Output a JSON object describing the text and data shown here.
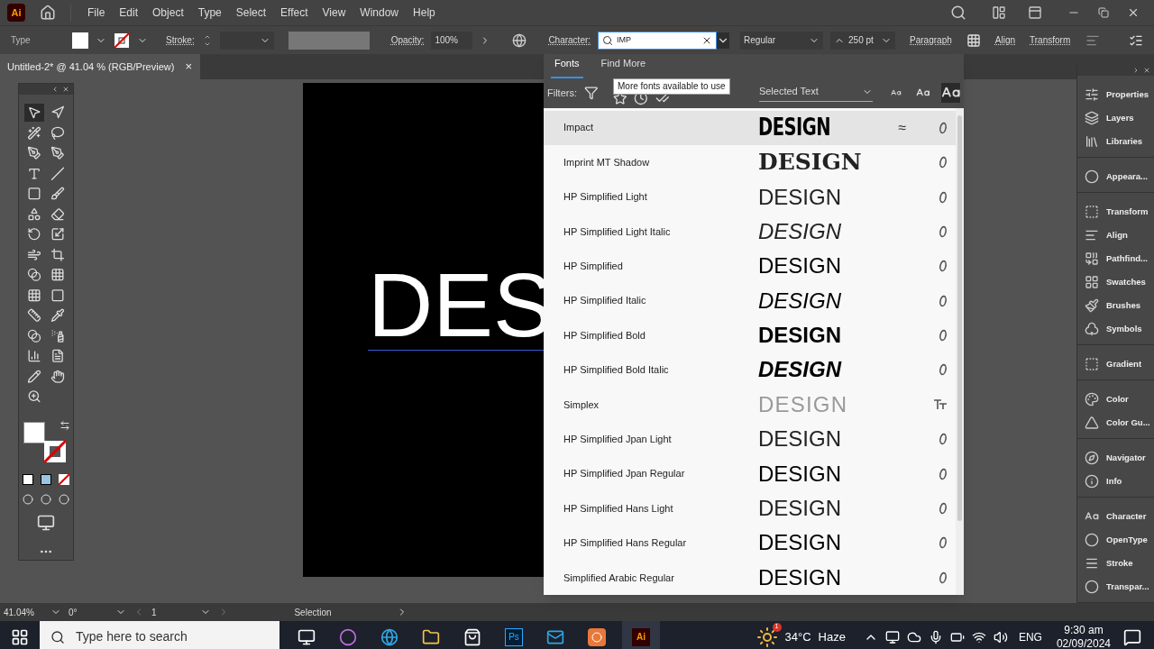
{
  "app_logo": "Ai",
  "menu": [
    "File",
    "Edit",
    "Object",
    "Type",
    "Select",
    "Effect",
    "View",
    "Window",
    "Help"
  ],
  "control_bar": {
    "mode": "Type",
    "stroke_label": "Stroke:",
    "opacity_label": "Opacity:",
    "opacity": "100%",
    "character_label": "Character:",
    "font_search": "IMP",
    "style": "Regular",
    "size": "250 pt",
    "links": [
      "Paragraph",
      "Align",
      "Transform"
    ]
  },
  "document_tab": {
    "title": "Untitled-2* @ 41.04 % (RGB/Preview)",
    "close": "×"
  },
  "tools": [
    {
      "selected": true
    },
    {
      "selected": false
    },
    {
      "selected": false
    },
    {
      "selected": false
    },
    {
      "selected": false
    },
    {
      "selected": false
    },
    {
      "selected": false
    },
    {
      "selected": false
    },
    {
      "selected": false
    },
    {
      "selected": false
    },
    {
      "selected": false
    },
    {
      "selected": false
    },
    {
      "selected": false
    },
    {
      "selected": false
    },
    {
      "selected": false
    },
    {
      "selected": false
    },
    {
      "selected": false
    },
    {
      "selected": false
    },
    {
      "selected": false
    },
    {
      "selected": false
    },
    {
      "selected": false
    },
    {
      "selected": false
    },
    {
      "selected": false
    },
    {
      "selected": false
    },
    {
      "selected": false
    },
    {
      "selected": false
    },
    {
      "selected": false
    },
    {
      "selected": false
    },
    {
      "selected": false
    }
  ],
  "artboard_text": "DES",
  "font_menu": {
    "tabs": [
      {
        "label": "Fonts",
        "selected": true
      },
      {
        "label": "Find More",
        "selected": false
      }
    ],
    "tooltip": "More fonts available to use",
    "filters_label": "Filters:",
    "sample": "Selected Text",
    "fonts": [
      {
        "name": "Impact",
        "preview": "DESIGN",
        "kind": "condensed",
        "truetype": false,
        "similar": "≈",
        "selected": true
      },
      {
        "name": "Imprint MT Shadow",
        "preview": "DESIGN",
        "kind": "serif",
        "truetype": false,
        "selected": false
      },
      {
        "name": "HP Simplified Light",
        "preview": "DESIGN",
        "kind": "light",
        "truetype": false,
        "selected": false
      },
      {
        "name": "HP Simplified Light Italic",
        "preview": "DESIGN",
        "kind": "light-italic",
        "truetype": false,
        "selected": false
      },
      {
        "name": "HP Simplified",
        "preview": "DESIGN",
        "kind": "regular",
        "truetype": false,
        "selected": false
      },
      {
        "name": "HP Simplified Italic",
        "preview": "DESIGN",
        "kind": "italic",
        "truetype": false,
        "selected": false
      },
      {
        "name": "HP Simplified Bold",
        "preview": "DESIGN",
        "kind": "bold",
        "truetype": false,
        "selected": false
      },
      {
        "name": "HP Simplified Bold Italic",
        "preview": "DESIGN",
        "kind": "bold-italic",
        "truetype": false,
        "selected": false
      },
      {
        "name": "Simplex",
        "preview": "DESIGN",
        "kind": "thin",
        "truetype": true,
        "selected": false
      },
      {
        "name": "HP Simplified Jpan Light",
        "preview": "DESIGN",
        "kind": "light",
        "truetype": false,
        "selected": false
      },
      {
        "name": "HP Simplified Jpan Regular",
        "preview": "DESIGN",
        "kind": "regular",
        "truetype": false,
        "selected": false
      },
      {
        "name": "HP Simplified Hans Light",
        "preview": "DESIGN",
        "kind": "light",
        "truetype": false,
        "selected": false
      },
      {
        "name": "HP Simplified Hans Regular",
        "preview": "DESIGN",
        "kind": "regular",
        "truetype": false,
        "selected": false
      },
      {
        "name": "Simplified Arabic Regular",
        "preview": "DESIGN",
        "kind": "regular",
        "truetype": false,
        "selected": false
      }
    ]
  },
  "panels": [
    [
      "Properties",
      "Layers",
      "Libraries"
    ],
    [
      "Appeara..."
    ],
    [
      "Transform",
      "Align",
      "Pathfind...",
      "Swatches",
      "Brushes",
      "Symbols"
    ],
    [
      "Gradient"
    ],
    [
      "Color",
      "Color Gu..."
    ],
    [
      "Navigator",
      "Info"
    ],
    [
      "Character",
      "OpenType",
      "Stroke",
      "Transpar..."
    ]
  ],
  "status_bar": {
    "zoom": "41.04%",
    "rotation": "0°",
    "artboard": "1",
    "tool": "Selection"
  },
  "taskbar": {
    "search_placeholder": "Type here to search",
    "ps_label": "Ps",
    "ai_label": "Ai",
    "temperature": "34°C",
    "weather": "Haze",
    "weather_badge": "1",
    "language": "ENG",
    "time": "9:30 am",
    "date": "02/09/2024"
  }
}
